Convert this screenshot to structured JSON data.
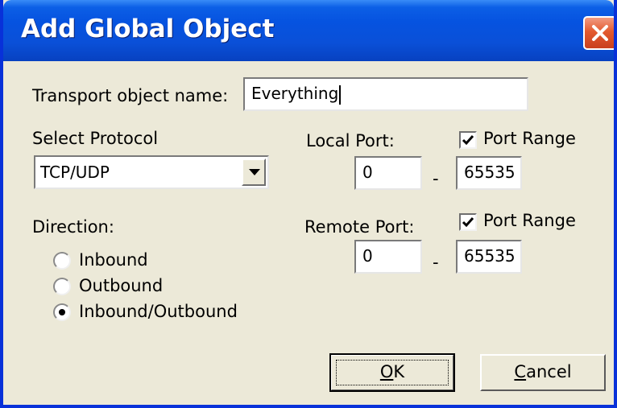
{
  "window": {
    "title": "Add Global Object"
  },
  "transport": {
    "label": "Transport object name:",
    "value": "Everything"
  },
  "protocol": {
    "label": "Select Protocol",
    "selected": "TCP/UDP"
  },
  "local_port": {
    "label": "Local Port:",
    "port_range_label": "Port Range",
    "port_range_checked": true,
    "from": "0",
    "separator": "-",
    "to": "65535"
  },
  "remote_port": {
    "label": "Remote Port:",
    "port_range_label": "Port Range",
    "port_range_checked": true,
    "from": "0",
    "separator": "-",
    "to": "65535"
  },
  "direction": {
    "label": "Direction:",
    "options": [
      {
        "label": "Inbound",
        "selected": false
      },
      {
        "label": "Outbound",
        "selected": false
      },
      {
        "label": "Inbound/Outbound",
        "selected": true
      }
    ]
  },
  "buttons": {
    "ok_label": "OK",
    "cancel_label": "Cancel"
  },
  "icons": {
    "close": "close-icon",
    "dropdown": "chevron-down-icon",
    "check": "check-icon"
  },
  "colors": {
    "titlebar": "#0653e0",
    "close_button": "#e35a2f",
    "dialog_bg": "#ece9d8"
  }
}
